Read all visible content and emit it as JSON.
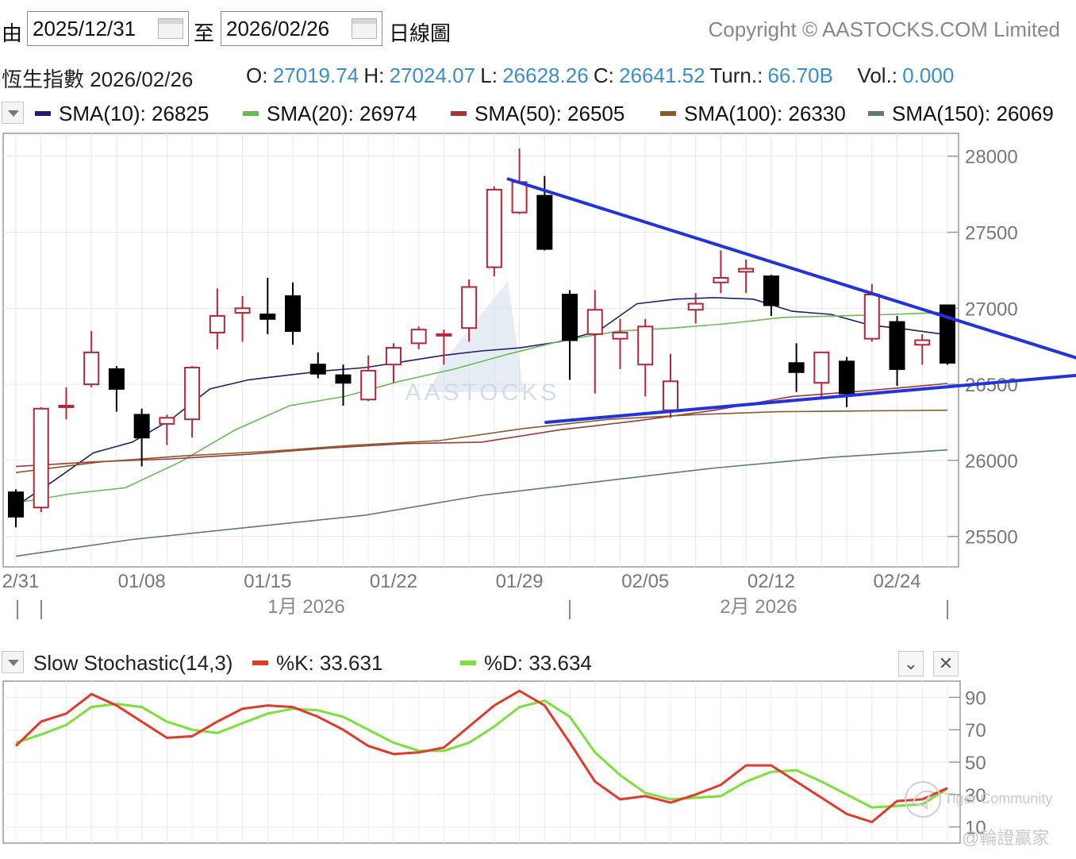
{
  "header": {
    "from_label": "由",
    "from_date": "2025/12/31",
    "to_label": "至",
    "to_date": "2026/02/26",
    "period": "日線圖",
    "copyright": "Copyright © AASTOCKS.COM Limited"
  },
  "quote": {
    "name": "恆生指數",
    "date": "2026/02/26",
    "o_label": "O:",
    "o": "27019.74",
    "h_label": "H:",
    "h": "27024.07",
    "l_label": "L:",
    "l": "26628.26",
    "c_label": "C:",
    "c": "26641.52",
    "turn_label": "Turn.:",
    "turn": "66.70B",
    "vol_label": "Vol.:",
    "vol": "0.000"
  },
  "legend": [
    {
      "label": "SMA(10): 26825",
      "color": "#1f1f6e"
    },
    {
      "label": "SMA(20): 26974",
      "color": "#66bb55"
    },
    {
      "label": "SMA(50): 26505",
      "color": "#a03838"
    },
    {
      "label": "SMA(100): 26330",
      "color": "#8b5a2b"
    },
    {
      "label": "SMA(150): 26069",
      "color": "#5e7a74"
    }
  ],
  "stoch": {
    "title": "Slow Stochastic(14,3)",
    "k_label": "%K: 33.631",
    "d_label": "%D: 33.634",
    "k_color": "#e03a2a",
    "d_color": "#7be03a"
  },
  "watermark": {
    "brand": "AASTOCKS",
    "community": "Tiger Community",
    "author": "@輪證贏家"
  },
  "colors": {
    "up": "#b8243a",
    "down": "#000000",
    "trendline": "#2233dd"
  },
  "chart_data": [
    {
      "type": "candlestick",
      "title": "恆生指數",
      "ylim": [
        25300,
        28150
      ],
      "yticks": [
        25500,
        26000,
        26500,
        27000,
        27500,
        28000
      ],
      "xtick_labels": [
        "2/31",
        "01/08",
        "01/15",
        "01/22",
        "01/29",
        "02/05",
        "02/12",
        "02/24"
      ],
      "month_labels": [
        "1月 2026",
        "2月 2026"
      ],
      "candles": [
        {
          "date": "12/31",
          "o": 25790,
          "h": 25810,
          "l": 25560,
          "c": 25630
        },
        {
          "date": "01/02",
          "o": 25690,
          "h": 26350,
          "l": 25660,
          "c": 26340
        },
        {
          "date": "01/05",
          "o": 26350,
          "h": 26480,
          "l": 26270,
          "c": 26360
        },
        {
          "date": "01/06",
          "o": 26500,
          "h": 26850,
          "l": 26480,
          "c": 26710
        },
        {
          "date": "01/07",
          "o": 26600,
          "h": 26620,
          "l": 26320,
          "c": 26470
        },
        {
          "date": "01/08",
          "o": 26300,
          "h": 26340,
          "l": 25960,
          "c": 26150
        },
        {
          "date": "01/09",
          "o": 26240,
          "h": 26300,
          "l": 26100,
          "c": 26280
        },
        {
          "date": "01/12",
          "o": 26270,
          "h": 26620,
          "l": 26150,
          "c": 26610
        },
        {
          "date": "01/13",
          "o": 26840,
          "h": 27130,
          "l": 26730,
          "c": 26950
        },
        {
          "date": "01/14",
          "o": 26970,
          "h": 27080,
          "l": 26780,
          "c": 27000
        },
        {
          "date": "01/15",
          "o": 26960,
          "h": 27200,
          "l": 26830,
          "c": 26930
        },
        {
          "date": "01/16",
          "o": 27080,
          "h": 27170,
          "l": 26760,
          "c": 26850
        },
        {
          "date": "01/19",
          "o": 26630,
          "h": 26710,
          "l": 26540,
          "c": 26570
        },
        {
          "date": "01/20",
          "o": 26560,
          "h": 26630,
          "l": 26360,
          "c": 26510
        },
        {
          "date": "01/21",
          "o": 26400,
          "h": 26690,
          "l": 26390,
          "c": 26590
        },
        {
          "date": "01/22",
          "o": 26630,
          "h": 26770,
          "l": 26510,
          "c": 26740
        },
        {
          "date": "01/23",
          "o": 26770,
          "h": 26880,
          "l": 26730,
          "c": 26860
        },
        {
          "date": "01/26",
          "o": 26820,
          "h": 26860,
          "l": 26630,
          "c": 26830
        },
        {
          "date": "01/27",
          "o": 26870,
          "h": 27190,
          "l": 26780,
          "c": 27140
        },
        {
          "date": "01/28",
          "o": 27270,
          "h": 27800,
          "l": 27210,
          "c": 27780
        },
        {
          "date": "01/29",
          "o": 27630,
          "h": 28050,
          "l": 27620,
          "c": 27830
        },
        {
          "date": "01/30",
          "o": 27740,
          "h": 27870,
          "l": 27380,
          "c": 27390
        },
        {
          "date": "02/02",
          "o": 27090,
          "h": 27120,
          "l": 26530,
          "c": 26790
        },
        {
          "date": "02/03",
          "o": 26830,
          "h": 27120,
          "l": 26440,
          "c": 26990
        },
        {
          "date": "02/04",
          "o": 26800,
          "h": 26930,
          "l": 26600,
          "c": 26840
        },
        {
          "date": "02/05",
          "o": 26630,
          "h": 26930,
          "l": 26420,
          "c": 26880
        },
        {
          "date": "02/06",
          "o": 26330,
          "h": 26700,
          "l": 26280,
          "c": 26520
        },
        {
          "date": "02/09",
          "o": 26990,
          "h": 27100,
          "l": 26900,
          "c": 27030
        },
        {
          "date": "02/10",
          "o": 27170,
          "h": 27380,
          "l": 27100,
          "c": 27200
        },
        {
          "date": "02/11",
          "o": 27240,
          "h": 27320,
          "l": 27100,
          "c": 27260
        },
        {
          "date": "02/12",
          "o": 27210,
          "h": 27220,
          "l": 26950,
          "c": 27020
        },
        {
          "date": "02/13",
          "o": 26640,
          "h": 26770,
          "l": 26450,
          "c": 26580
        },
        {
          "date": "02/16",
          "o": 26510,
          "h": 26700,
          "l": 26400,
          "c": 26710
        },
        {
          "date": "02/17",
          "o": 26650,
          "h": 26680,
          "l": 26350,
          "c": 26440
        },
        {
          "date": "02/23",
          "o": 26800,
          "h": 27160,
          "l": 26780,
          "c": 27090
        },
        {
          "date": "02/24",
          "o": 26910,
          "h": 26950,
          "l": 26490,
          "c": 26600
        },
        {
          "date": "02/25",
          "o": 26760,
          "h": 26830,
          "l": 26630,
          "c": 26790
        },
        {
          "date": "02/26",
          "o": 27019.74,
          "h": 27024.07,
          "l": 26628.26,
          "c": 26641.52
        }
      ],
      "sma": {
        "SMA(10)": [
          25700,
          25870,
          26050,
          26120,
          26270,
          26470,
          26530,
          26560,
          26590,
          26610,
          26650,
          26690,
          26720,
          26740,
          26780,
          26850,
          27030,
          27060,
          27070,
          27060,
          26980,
          26960,
          26890,
          26860,
          26825
        ],
        "SMA(20)": [
          25720,
          25780,
          25820,
          25990,
          26200,
          26360,
          26420,
          26520,
          26600,
          26700,
          26790,
          26850,
          26870,
          26900,
          26940,
          26950,
          26960,
          26974
        ],
        "SMA(50)": [
          25960,
          25990,
          26010,
          26040,
          26080,
          26110,
          26120,
          26200,
          26260,
          26330,
          26420,
          26460,
          26505
        ],
        "SMA(100)": [
          25920,
          25990,
          26030,
          26060,
          26100,
          26130,
          26210,
          26270,
          26300,
          26320,
          26325,
          26330
        ],
        "SMA(150)": [
          25370,
          25480,
          25560,
          25640,
          25770,
          25860,
          25950,
          26020,
          26069
        ]
      },
      "trendlines": [
        {
          "from": [
            "01/29",
            27850
          ],
          "to": [
            "02/26+",
            26670
          ]
        },
        {
          "from": [
            "01/31",
            26250
          ],
          "to": [
            "02/26+",
            26560
          ]
        }
      ]
    },
    {
      "type": "line",
      "title": "Slow Stochastic(14,3)",
      "ylim": [
        0,
        100
      ],
      "yticks": [
        10,
        30,
        50,
        70,
        90
      ],
      "series": [
        {
          "name": "%K",
          "values": [
            60,
            75,
            80,
            92,
            85,
            75,
            65,
            66,
            75,
            83,
            85,
            84,
            78,
            70,
            60,
            55,
            56,
            59,
            72,
            85,
            94,
            85,
            62,
            38,
            27,
            29,
            25,
            30,
            36,
            48,
            48,
            38,
            28,
            18,
            13,
            26,
            27,
            34
          ]
        },
        {
          "name": "%D",
          "values": [
            62,
            67,
            73,
            84,
            86,
            84,
            75,
            70,
            68,
            74,
            80,
            83,
            82,
            78,
            70,
            62,
            57,
            57,
            62,
            72,
            84,
            88,
            78,
            56,
            42,
            31,
            27,
            28,
            29,
            38,
            44,
            45,
            38,
            30,
            22,
            23,
            24,
            33.6
          ]
        }
      ]
    }
  ]
}
